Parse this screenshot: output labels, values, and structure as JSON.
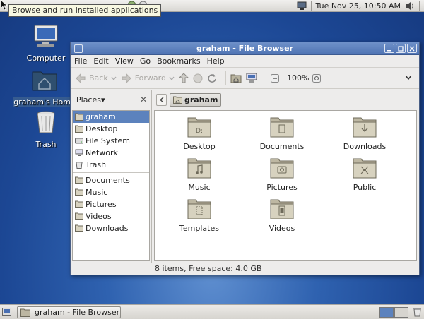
{
  "top_panel": {
    "clock": "Tue Nov 25, 10:50 AM",
    "tooltip": "Browse and run installed applications"
  },
  "desktop": {
    "icons": [
      {
        "label": "Computer"
      },
      {
        "label": "graham's Home"
      },
      {
        "label": "Trash"
      }
    ]
  },
  "window": {
    "title": "graham - File Browser",
    "menu": [
      "File",
      "Edit",
      "View",
      "Go",
      "Bookmarks",
      "Help"
    ],
    "toolbar": {
      "back": "Back",
      "forward": "Forward",
      "zoom": "100%"
    },
    "sidebar": {
      "header": "Places",
      "places": [
        "graham",
        "Desktop",
        "File System",
        "Network",
        "Trash"
      ],
      "bookmarks": [
        "Documents",
        "Music",
        "Pictures",
        "Videos",
        "Downloads"
      ]
    },
    "path": {
      "crumb": "graham"
    },
    "files": [
      "Desktop",
      "Documents",
      "Downloads",
      "Music",
      "Pictures",
      "Public",
      "Templates",
      "Videos"
    ],
    "status": "8 items, Free space: 4.0 GB"
  },
  "bottom_panel": {
    "task": "graham - File Browser"
  },
  "colors": {
    "selection": "#5c82bd",
    "titlebar": "#5a7fbe",
    "desktop": "#2f62b0"
  }
}
